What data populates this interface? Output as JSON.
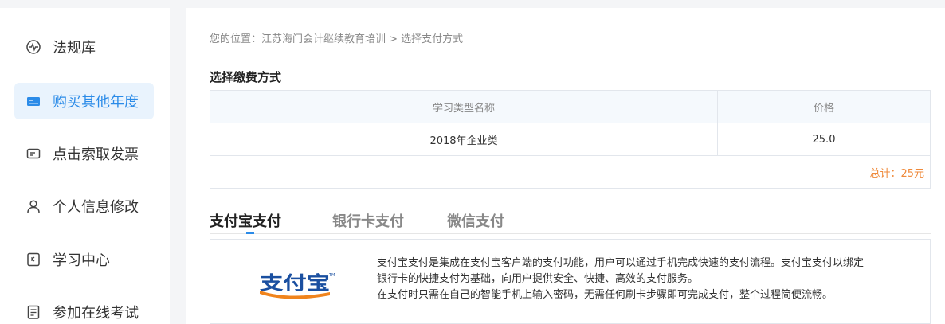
{
  "sidebar": {
    "items": [
      {
        "label": "法规库",
        "icon": "pulse-circle-icon",
        "active": false
      },
      {
        "label": "购买其他年度",
        "icon": "card-icon",
        "active": true
      },
      {
        "label": "点击索取发票",
        "icon": "invoice-icon",
        "active": false
      },
      {
        "label": "个人信息修改",
        "icon": "user-icon",
        "active": false
      },
      {
        "label": "学习中心",
        "icon": "book-icon",
        "active": false
      },
      {
        "label": "参加在线考试",
        "icon": "exam-icon",
        "active": false
      }
    ]
  },
  "breadcrumb": "您的位置：江苏海门会计继续教育培训 > 选择支付方式",
  "payment_section_title": "选择缴费方式",
  "price_table": {
    "headers": [
      "学习类型名称",
      "价格"
    ],
    "rows": [
      [
        "2018年企业类",
        "25.0"
      ]
    ],
    "total": "总计：25元"
  },
  "pay_tabs": [
    {
      "label": "支付宝支付",
      "active": true
    },
    {
      "label": "银行卡支付",
      "active": false
    },
    {
      "label": "微信支付",
      "active": false
    }
  ],
  "alipay": {
    "logo_text": "支付宝",
    "logo_mark": "TM",
    "description": [
      "支付宝支付是集成在支付宝客户端的支付功能，用户可以通过手机完成快速的支付流程。支付宝支付以绑定",
      "银行卡的快捷支付为基础，向用户提供安全、快捷、高效的支付服务。",
      "在支付时只需在自己的智能手机上输入密码，无需任何刷卡步骤即可完成支付，整个过程简便流畅。"
    ]
  },
  "colors": {
    "accent": "#2b8be8",
    "active_bg": "#e9f3fd",
    "total": "#ef8a3b",
    "alipay_blue": "#1a4fa0",
    "alipay_orange": "#f0841d"
  }
}
